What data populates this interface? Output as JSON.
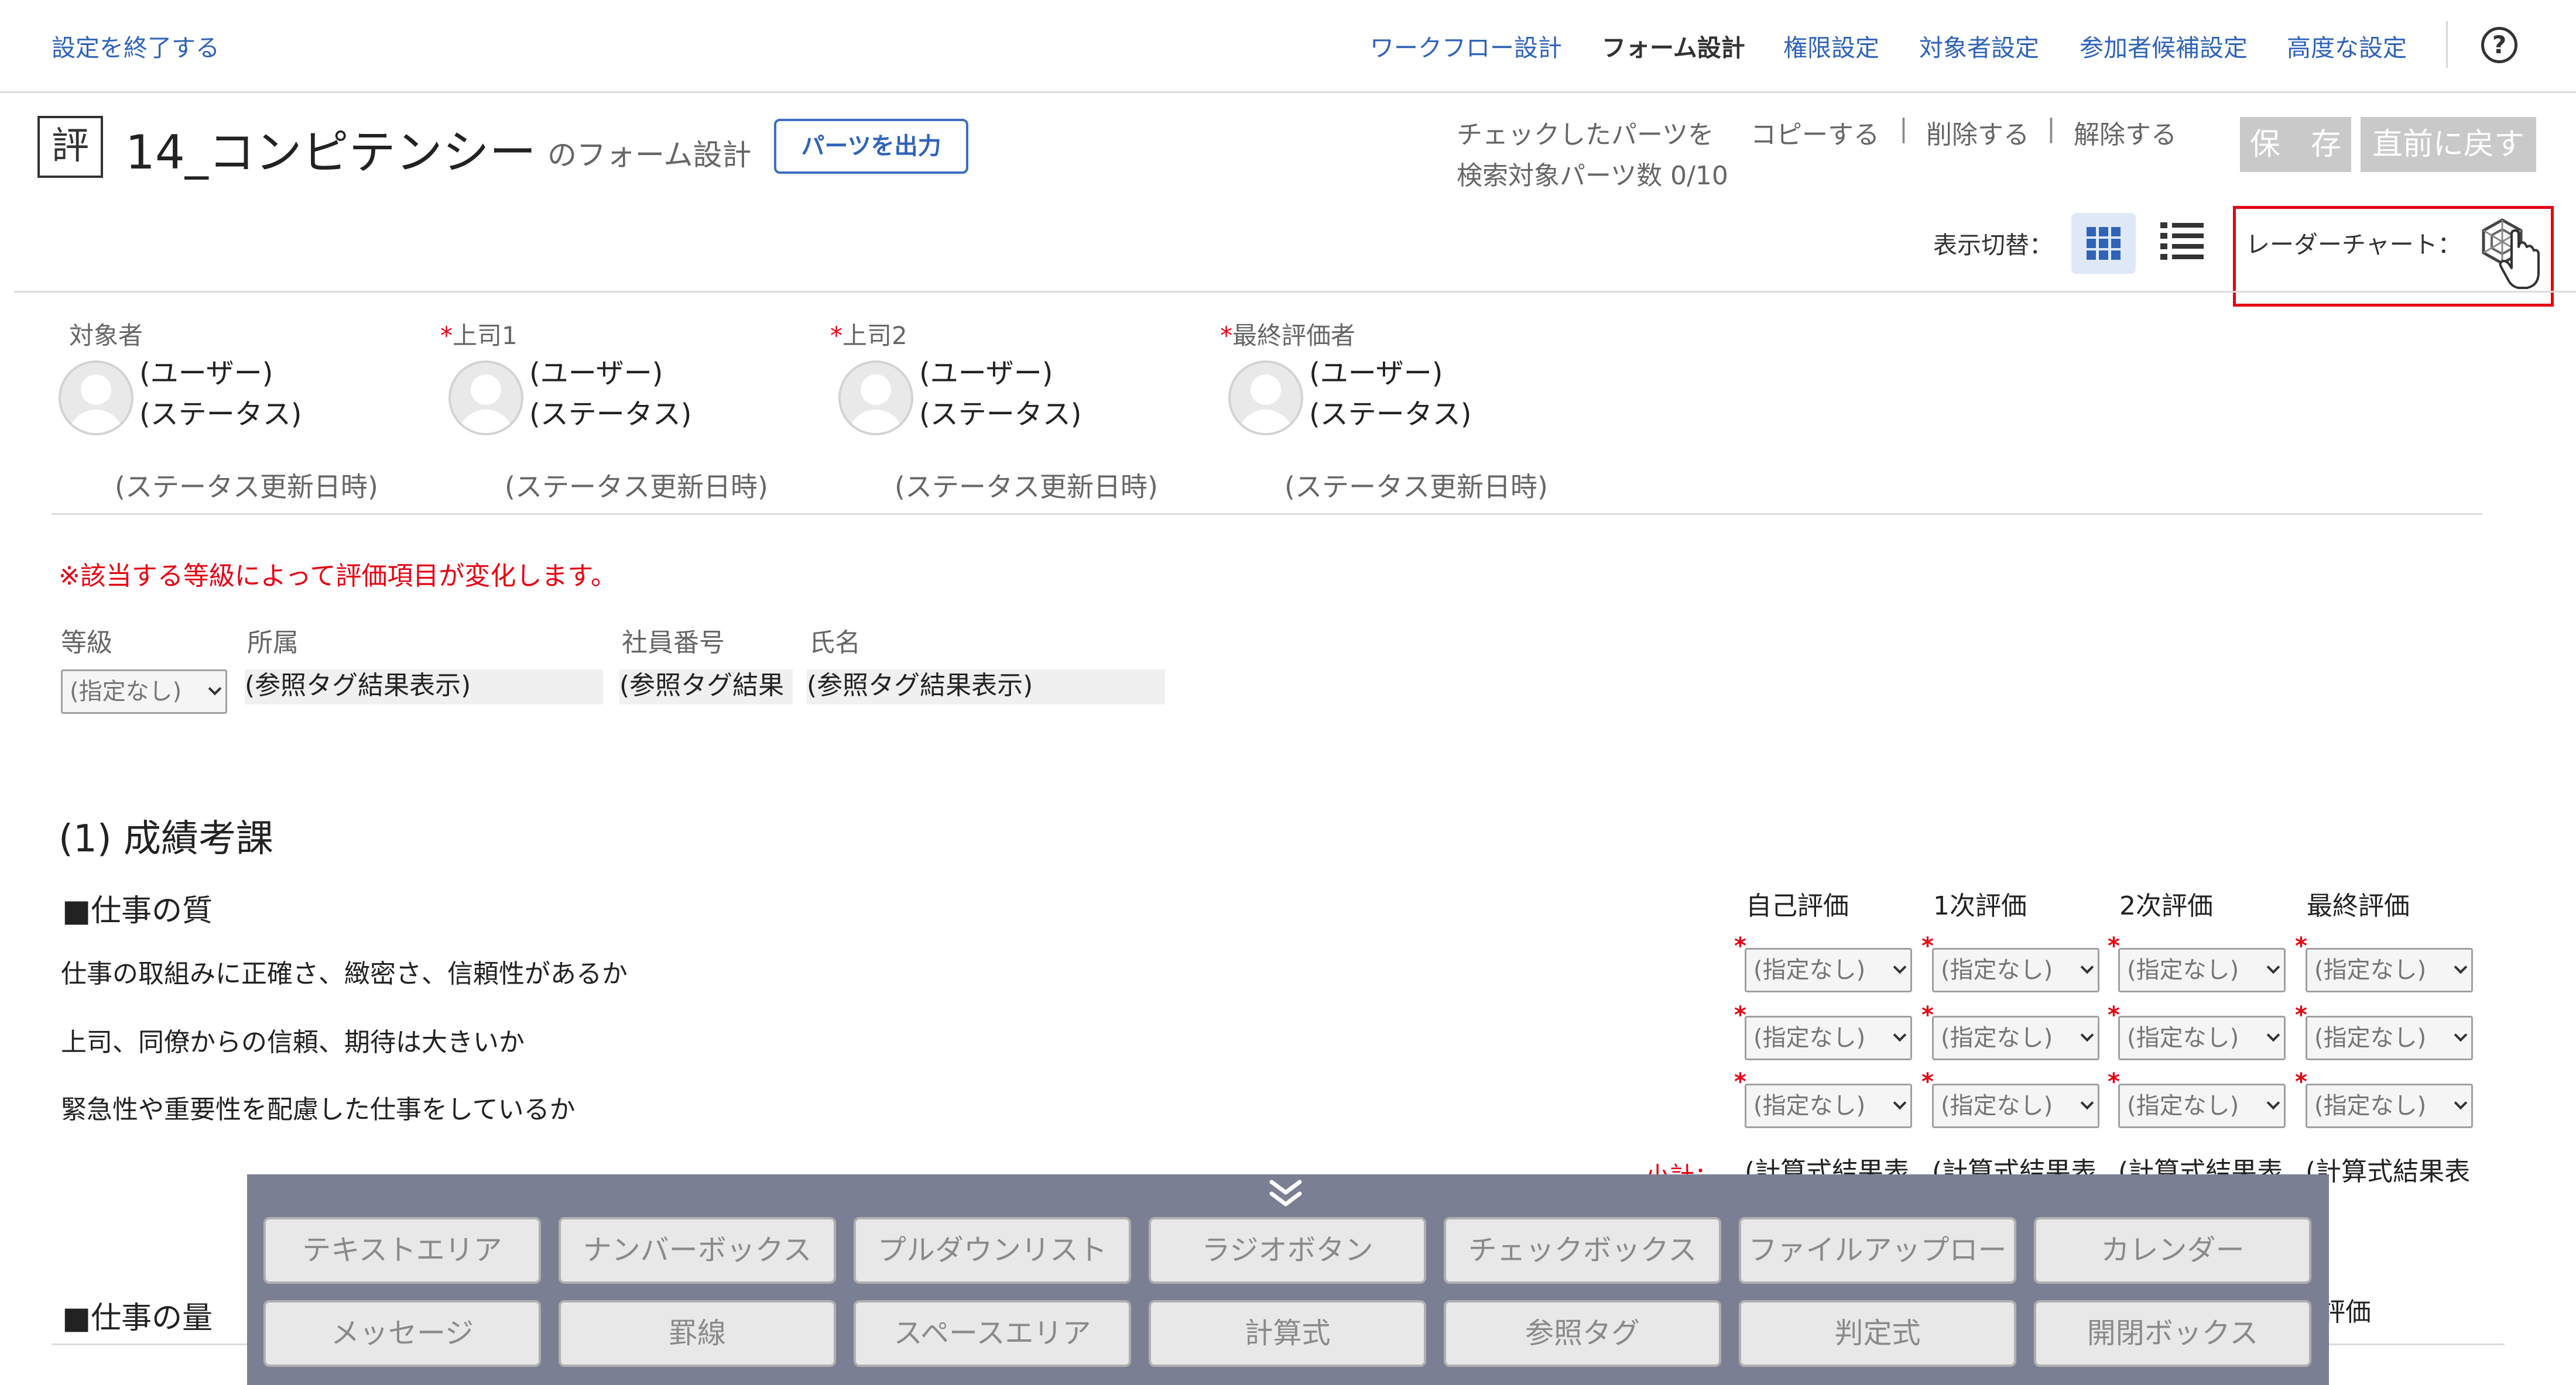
{
  "top_nav": {
    "exit_link": "設定を終了する",
    "items": [
      "ワークフロー設計",
      "フォーム設計",
      "権限設定",
      "対象者設定",
      "参加者候補設定",
      "高度な設定"
    ],
    "help": "?"
  },
  "header": {
    "icon_char": "評",
    "form_title": "14_コンピテンシー",
    "subtitle": "のフォーム設計",
    "export_button": "パーツを出力",
    "checked_parts_label": "チェックしたパーツを",
    "copy_link": "コピーする",
    "delete_link": "削除する",
    "release_link": "解除する",
    "separator": "|",
    "search_parts_count": "検索対象パーツ数 0/10",
    "save_button": "保　存",
    "revert_button": "直前に戻す",
    "view_switch_label": "表示切替：",
    "radar_chart_label": "レーダーチャート："
  },
  "participants": [
    {
      "label": "対象者",
      "required": false,
      "user": "(ユーザー)",
      "status": "(ステータス)",
      "date": "(ステータス更新日時)"
    },
    {
      "label": "上司1",
      "required": true,
      "user": "(ユーザー)",
      "status": "(ステータス)",
      "date": "(ステータス更新日時)"
    },
    {
      "label": "上司2",
      "required": true,
      "user": "(ユーザー)",
      "status": "(ステータス)",
      "date": "(ステータス更新日時)"
    },
    {
      "label": "最終評価者",
      "required": true,
      "user": "(ユーザー)",
      "status": "(ステータス)",
      "date": "(ステータス更新日時)"
    }
  ],
  "form": {
    "notice": "※該当する等級によって評価項目が変化します。",
    "fields": {
      "grade_label": "等級",
      "grade_value": "(指定なし)",
      "dept_label": "所属",
      "dept_value": "(参照タグ結果表示)",
      "emp_label": "社員番号",
      "emp_value": "(参照タグ結果",
      "name_label": "氏名",
      "name_value": "(参照タグ結果表示)"
    },
    "section_title": "(1) 成績考課",
    "subsection_quality": "■仕事の質",
    "subsection_quantity": "■仕事の量",
    "columns": [
      "自己評価",
      "1次評価",
      "2次評価",
      "最終評価"
    ],
    "questions": [
      "仕事の取組みに正確さ、緻密さ、信頼性があるか",
      "上司、同僚からの信頼、期待は大きいか",
      "緊急性や重要性を配慮した仕事をしているか"
    ],
    "select_placeholder": "(指定なし)",
    "subtotal_label": "小計：",
    "calc_result": "(計算式結果表",
    "final_eval_partial": "最終評価",
    "required_star": "*"
  },
  "palette": {
    "row1": [
      "テキストエリア",
      "ナンバーボックス",
      "プルダウンリスト",
      "ラジオボタン",
      "チェックボックス",
      "ファイルアップロード",
      "カレンダー"
    ],
    "row2": [
      "メッセージ",
      "罫線",
      "スペースエリア",
      "計算式",
      "参照タグ",
      "判定式",
      "開閉ボックス"
    ]
  },
  "colors": {
    "link_blue": "#2f63b8",
    "required_red": "#e60012",
    "palette_bg": "#7b7f94",
    "disabled_btn": "#c9c9c9"
  }
}
